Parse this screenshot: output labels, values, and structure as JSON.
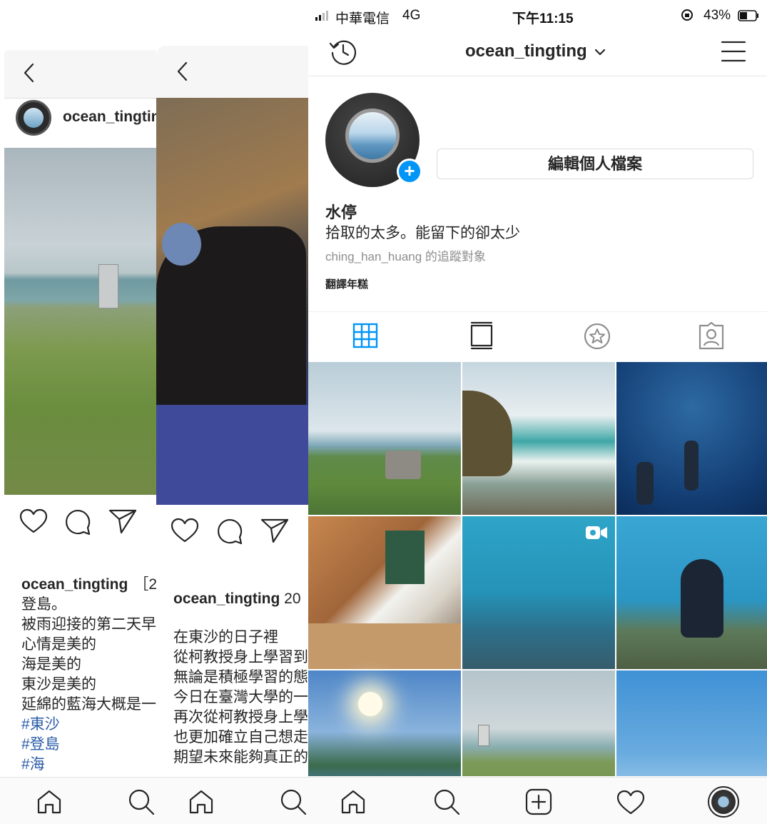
{
  "panel1": {
    "username": "ocean_tingting",
    "caption_username": "ocean_tingting",
    "caption_cont": "［2",
    "caption_lines": [
      "登島。",
      "被雨迎接的第二天早",
      "心情是美的",
      "海是美的",
      "東沙是美的",
      "延綿的藍海大概是一"
    ],
    "hashtags": [
      "#東沙",
      "#登島",
      "#海"
    ]
  },
  "panel2": {
    "caption_username": "ocean_tingting",
    "caption_cont": " 20",
    "caption_lines": [
      "在東沙的日子裡",
      "從柯教授身上學習到",
      "無論是積極學習的態",
      "今日在臺灣大學的一",
      "再次從柯教授身上學",
      "也更加確立自己想走",
      "期望未來能夠真正的"
    ]
  },
  "profile": {
    "status": {
      "carrier": "中華電信",
      "network": "4G",
      "time": "下午11:15",
      "battery": "43%"
    },
    "username": "ocean_tingting",
    "edit_profile": "編輯個人檔案",
    "name": "水停",
    "bio": "拾取的太多。能留下的卻太少",
    "followed_by": "ching_han_huang 的追蹤對象",
    "translate": "翻譯年糕"
  },
  "grid": [
    {
      "desc": "coast-grass-bollard",
      "video": false
    },
    {
      "desc": "rocky-shore-waves",
      "video": false
    },
    {
      "desc": "divers-bubbles",
      "video": false
    },
    {
      "desc": "classroom-lecture",
      "video": false
    },
    {
      "desc": "coral-fish",
      "video": true
    },
    {
      "desc": "diver-reef",
      "video": false
    },
    {
      "desc": "sun-pool",
      "video": false
    },
    {
      "desc": "beach-hut",
      "video": false
    },
    {
      "desc": "sky-island",
      "video": false
    }
  ],
  "colors": {
    "accent": "#0095f6",
    "link": "#2b5ca8",
    "text": "#262626",
    "muted": "#8e8e8e"
  }
}
